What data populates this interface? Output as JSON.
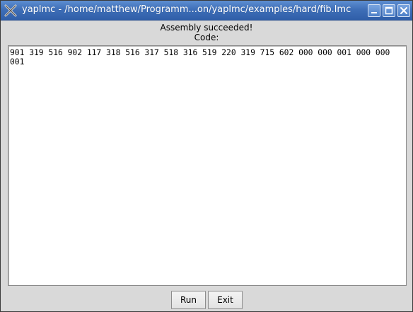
{
  "window": {
    "title": "yaplmc - /home/matthew/Programm...on/yaplmc/examples/hard/fib.lmc"
  },
  "status": {
    "message": "Assembly succeeded!",
    "code_label": "Code:"
  },
  "code": {
    "text": "901 319 516 902 117 318 516 317 518 316 519 220 319 715 602 000 000 001 000 000 001"
  },
  "buttons": {
    "run_label": "Run",
    "exit_label": "Exit"
  },
  "colors": {
    "titlebar": "#3f6fb8",
    "window_bg": "#d9d9d9",
    "text_area_bg": "#ffffff"
  }
}
